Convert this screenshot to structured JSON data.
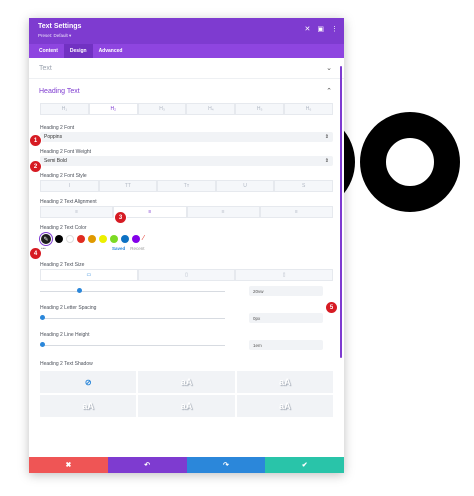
{
  "header": {
    "title": "Text Settings",
    "preset": "Preset: Default ▾"
  },
  "tabs": [
    {
      "label": "Content"
    },
    {
      "label": "Design"
    },
    {
      "label": "Advanced"
    }
  ],
  "sections": {
    "text": "Text",
    "heading_text": "Heading Text"
  },
  "heading_tabs": [
    "H₁",
    "H₂",
    "H₃",
    "H₄",
    "H₅",
    "H₆"
  ],
  "fields": {
    "font_label": "Heading 2 Font",
    "font_value": "Poppins",
    "weight_label": "Heading 2 Font Weight",
    "weight_value": "Semi Bold",
    "style_label": "Heading 2 Font Style",
    "style_options": [
      "I",
      "TT",
      "Tт",
      "U",
      "S"
    ],
    "align_label": "Heading 2 Text Alignment",
    "align_options": [
      "≡",
      "≡",
      "≡",
      "≡"
    ],
    "color_label": "Heading 2 Text Color",
    "color_status": {
      "saved": "Saved",
      "recent": "Recent"
    },
    "dots": "•••",
    "size_label": "Heading 2 Text Size",
    "size_value": "20vw",
    "spacing_label": "Heading 2 Letter Spacing",
    "spacing_value": "0px",
    "line_height_label": "Heading 2 Line Height",
    "line_height_value": "1em",
    "shadow_label": "Heading 2 Text Shadow",
    "shadow_samples": [
      "⊘",
      "aA",
      "aA",
      "aA",
      "aA",
      "aA"
    ]
  },
  "swatch_colors": [
    "#000000",
    "#ffffff",
    "#e02b20",
    "#e09900",
    "#edf000",
    "#7cda24",
    "#0c71c3",
    "#8300e9"
  ],
  "slider_levels": {
    "size": 0.2,
    "spacing": 0.0,
    "line_height": 0.0
  },
  "badges": [
    "1",
    "2",
    "3",
    "4",
    "5"
  ],
  "footer": {
    "cancel": "✖",
    "undo": "↶",
    "redo": "↷",
    "save": "✔"
  },
  "colors": {
    "purple": "#7e3bd0",
    "red": "#ef5555",
    "blue": "#2b87da",
    "green": "#29c4a9",
    "badge": "#d61b23"
  }
}
